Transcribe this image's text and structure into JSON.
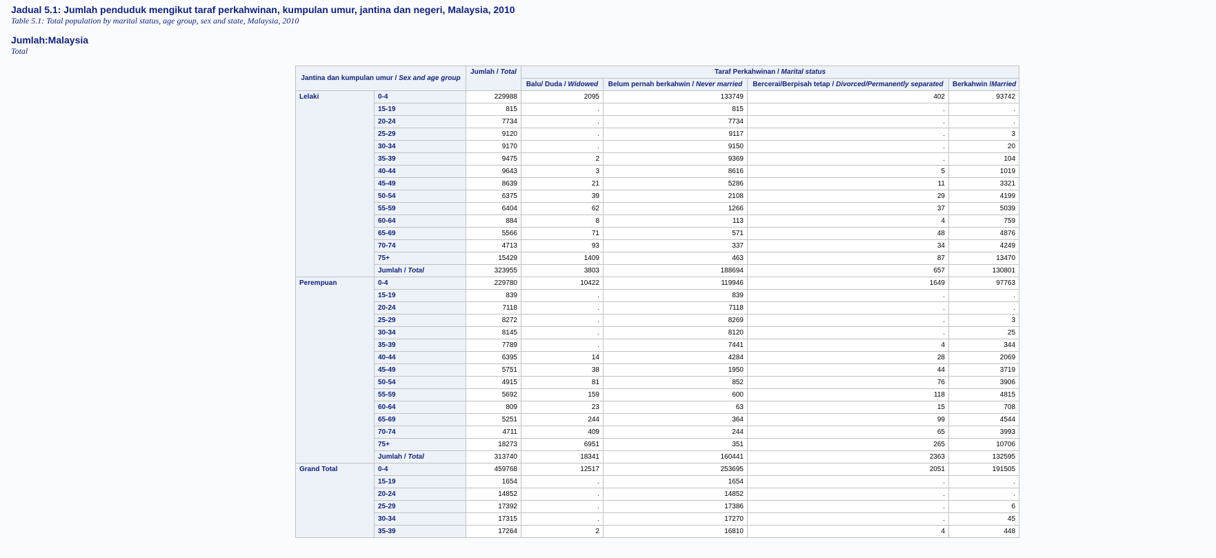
{
  "title": {
    "main": "Jadual 5.1: Jumlah penduduk mengikut taraf perkahwinan, kumpulan umur, jantina dan negeri, Malaysia, 2010",
    "sub": "Table 5.1: Total population by marital status, age group, sex and state, Malaysia, 2010"
  },
  "region": {
    "main": "Jumlah:Malaysia",
    "sub": "Total"
  },
  "header": {
    "sex_age": "Jantina dan kumpulan umur / ",
    "sex_age_en": "Sex and age group",
    "total": "Jumlah / ",
    "total_en": "Total",
    "marital": "Taraf Perkahwinan / ",
    "marital_en": "Marital status",
    "cols": [
      {
        "ms": "Balu/ Duda / ",
        "en": "Widowed"
      },
      {
        "ms": "Belum pernah berkahwin / ",
        "en": "Never married"
      },
      {
        "ms": "Bercerai/Berpisah tetap / ",
        "en": "Divorced/Permanently separated"
      },
      {
        "ms": "Berkahwin /",
        "en": "Married"
      }
    ]
  },
  "groups": [
    {
      "label": "Lelaki",
      "rows": [
        [
          "0-4",
          "229988",
          "2095",
          "133749",
          "402",
          "93742"
        ],
        [
          "15-19",
          "815",
          ".",
          "815",
          ".",
          "."
        ],
        [
          "20-24",
          "7734",
          ".",
          "7734",
          ".",
          "."
        ],
        [
          "25-29",
          "9120",
          ".",
          "9117",
          ".",
          "3"
        ],
        [
          "30-34",
          "9170",
          ".",
          "9150",
          ".",
          "20"
        ],
        [
          "35-39",
          "9475",
          "2",
          "9369",
          ".",
          "104"
        ],
        [
          "40-44",
          "9643",
          "3",
          "8616",
          "5",
          "1019"
        ],
        [
          "45-49",
          "8639",
          "21",
          "5286",
          "11",
          "3321"
        ],
        [
          "50-54",
          "6375",
          "39",
          "2108",
          "29",
          "4199"
        ],
        [
          "55-59",
          "6404",
          "62",
          "1266",
          "37",
          "5039"
        ],
        [
          "60-64",
          "884",
          "8",
          "113",
          "4",
          "759"
        ],
        [
          "65-69",
          "5566",
          "71",
          "571",
          "48",
          "4876"
        ],
        [
          "70-74",
          "4713",
          "93",
          "337",
          "34",
          "4249"
        ],
        [
          "75+",
          "15429",
          "1409",
          "463",
          "87",
          "13470"
        ],
        [
          "Jumlah / Total",
          "323955",
          "3803",
          "188694",
          "657",
          "130801"
        ]
      ]
    },
    {
      "label": "Perempuan",
      "rows": [
        [
          "0-4",
          "229780",
          "10422",
          "119946",
          "1649",
          "97763"
        ],
        [
          "15-19",
          "839",
          ".",
          "839",
          ".",
          "."
        ],
        [
          "20-24",
          "7118",
          ".",
          "7118",
          ".",
          "."
        ],
        [
          "25-29",
          "8272",
          ".",
          "8269",
          ".",
          "3"
        ],
        [
          "30-34",
          "8145",
          ".",
          "8120",
          ".",
          "25"
        ],
        [
          "35-39",
          "7789",
          ".",
          "7441",
          "4",
          "344"
        ],
        [
          "40-44",
          "6395",
          "14",
          "4284",
          "28",
          "2069"
        ],
        [
          "45-49",
          "5751",
          "38",
          "1950",
          "44",
          "3719"
        ],
        [
          "50-54",
          "4915",
          "81",
          "852",
          "76",
          "3906"
        ],
        [
          "55-59",
          "5692",
          "159",
          "600",
          "118",
          "4815"
        ],
        [
          "60-64",
          "809",
          "23",
          "63",
          "15",
          "708"
        ],
        [
          "65-69",
          "5251",
          "244",
          "364",
          "99",
          "4544"
        ],
        [
          "70-74",
          "4711",
          "409",
          "244",
          "65",
          "3993"
        ],
        [
          "75+",
          "18273",
          "6951",
          "351",
          "265",
          "10706"
        ],
        [
          "Jumlah / Total",
          "313740",
          "18341",
          "160441",
          "2363",
          "132595"
        ]
      ]
    },
    {
      "label": "Grand Total",
      "rows": [
        [
          "0-4",
          "459768",
          "12517",
          "253695",
          "2051",
          "191505"
        ],
        [
          "15-19",
          "1654",
          ".",
          "1654",
          ".",
          "."
        ],
        [
          "20-24",
          "14852",
          ".",
          "14852",
          ".",
          "."
        ],
        [
          "25-29",
          "17392",
          ".",
          "17386",
          ".",
          "6"
        ],
        [
          "30-34",
          "17315",
          ".",
          "17270",
          ".",
          "45"
        ],
        [
          "35-39",
          "17264",
          "2",
          "16810",
          "4",
          "448"
        ]
      ]
    }
  ]
}
